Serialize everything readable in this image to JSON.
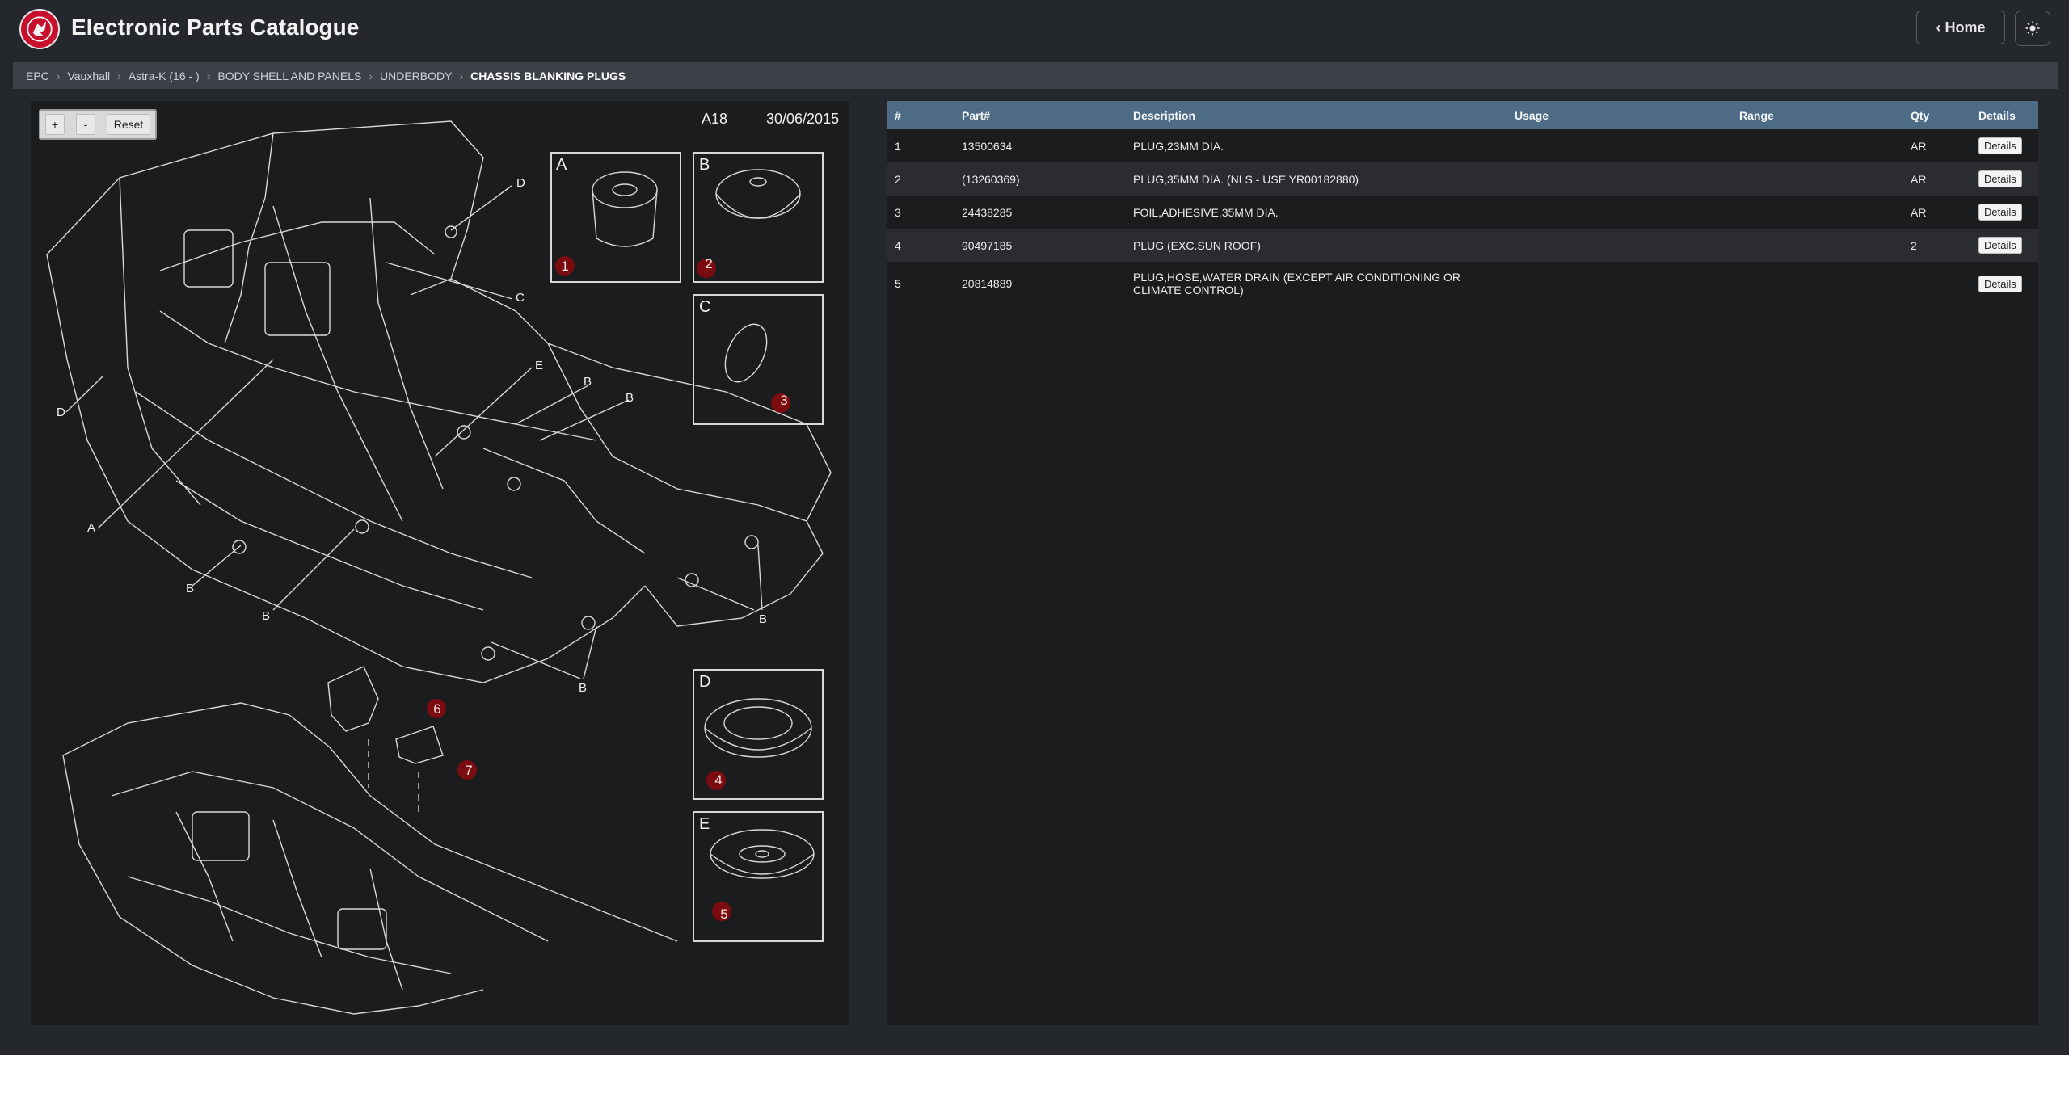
{
  "app": {
    "title": "Electronic Parts Catalogue",
    "logo_icon": "griffin-logo-icon",
    "brand_color": "#c8102e"
  },
  "header": {
    "home_label": "‹ Home",
    "theme_icon": "sun-icon"
  },
  "breadcrumb": [
    "EPC",
    "Vauxhall",
    "Astra-K (16 - )",
    "BODY SHELL AND PANELS",
    "UNDERBODY",
    "CHASSIS BLANKING PLUGS"
  ],
  "diagram": {
    "zoom_in": "+",
    "zoom_out": "-",
    "reset": "Reset",
    "code": "A18",
    "date": "30/06/2015",
    "callout_letters": [
      "A",
      "B",
      "C",
      "D",
      "E"
    ],
    "part_markers": [
      "1",
      "2",
      "3",
      "4",
      "5",
      "6",
      "7"
    ],
    "body_labels": [
      "D",
      "C",
      "D",
      "E",
      "B",
      "B",
      "A",
      "B",
      "B",
      "B",
      "B"
    ]
  },
  "table": {
    "headers": [
      "#",
      "Part#",
      "Description",
      "Usage",
      "Range",
      "Qty",
      "Details"
    ],
    "rows": [
      {
        "num": "1",
        "part": "13500634",
        "desc": "PLUG,23MM DIA.",
        "desc2": "",
        "usage": "",
        "range": "",
        "qty": "AR",
        "details": "Details"
      },
      {
        "num": "2",
        "part": "(13260369)",
        "desc": "PLUG,35MM DIA. (NLS.- USE YR00182880)",
        "desc2": "",
        "usage": "",
        "range": "",
        "qty": "AR",
        "details": "Details"
      },
      {
        "num": "3",
        "part": "24438285",
        "desc": "FOIL,ADHESIVE,35MM DIA.",
        "desc2": "",
        "usage": "",
        "range": "",
        "qty": "AR",
        "details": "Details"
      },
      {
        "num": "4",
        "part": "90497185",
        "desc": "PLUG (EXC.SUN ROOF)",
        "desc2": "",
        "usage": "",
        "range": "",
        "qty": "2",
        "details": "Details"
      },
      {
        "num": "5",
        "part": "20814889",
        "desc": "PLUG,HOSE,WATER DRAIN (EXCEPT AIR CONDITIONING OR",
        "desc2": "CLIMATE CONTROL)",
        "usage": "",
        "range": "",
        "qty": "",
        "details": "Details"
      }
    ]
  }
}
